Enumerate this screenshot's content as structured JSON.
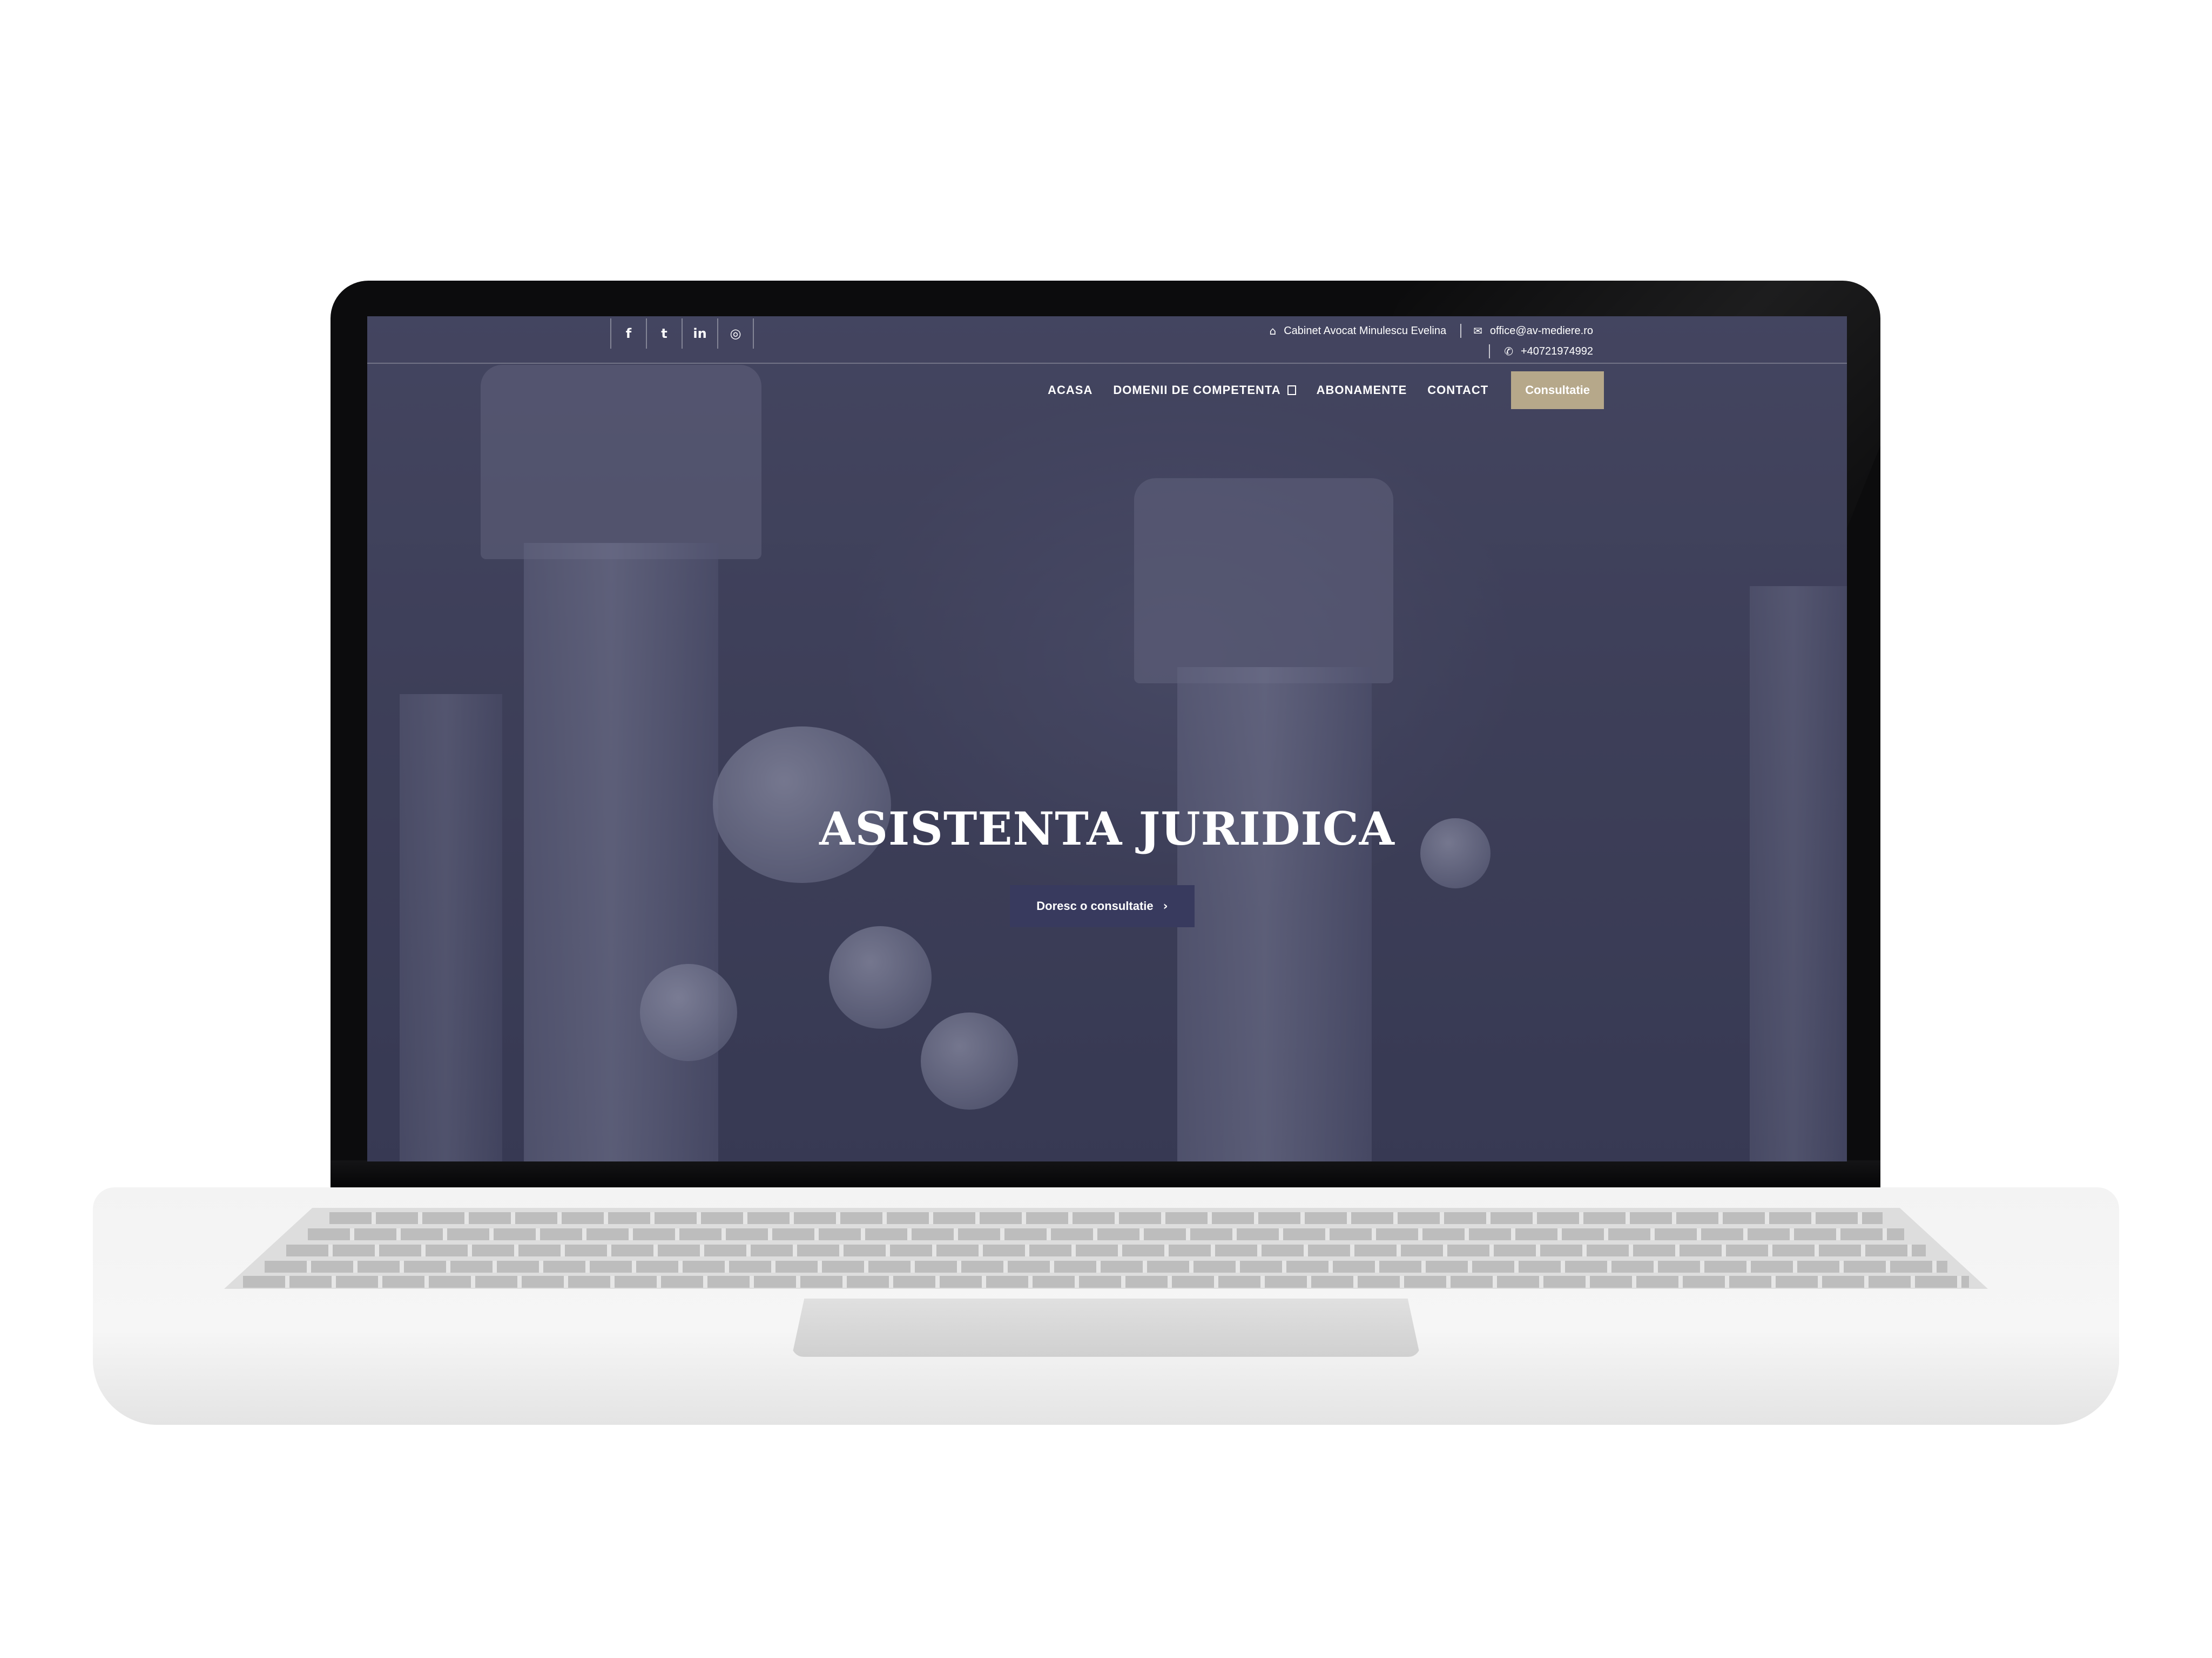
{
  "topbar": {
    "socials": [
      {
        "icon": "facebook-icon",
        "glyph": "f"
      },
      {
        "icon": "twitter-icon",
        "glyph": "t"
      },
      {
        "icon": "linkedin-icon",
        "glyph": "in"
      },
      {
        "icon": "instagram-icon",
        "glyph": "◎"
      }
    ],
    "company": "Cabinet Avocat Minulescu Evelina",
    "email": "office@av-mediere.ro",
    "phone": "+40721974992",
    "icons": {
      "company": "bank-icon",
      "email": "envelope-icon",
      "phone": "phone-icon"
    }
  },
  "nav": {
    "items": [
      "ACASA",
      "DOMENII DE COMPETENTA",
      "ABONAMENTE",
      "CONTACT"
    ],
    "cta": "Consultatie"
  },
  "hero": {
    "title": "ASISTENTA JURIDICA",
    "button": "Doresc o consultatie"
  },
  "colors": {
    "accent": "#b6a88a",
    "button": "#383a5e",
    "overlay": "#4b4d66"
  }
}
